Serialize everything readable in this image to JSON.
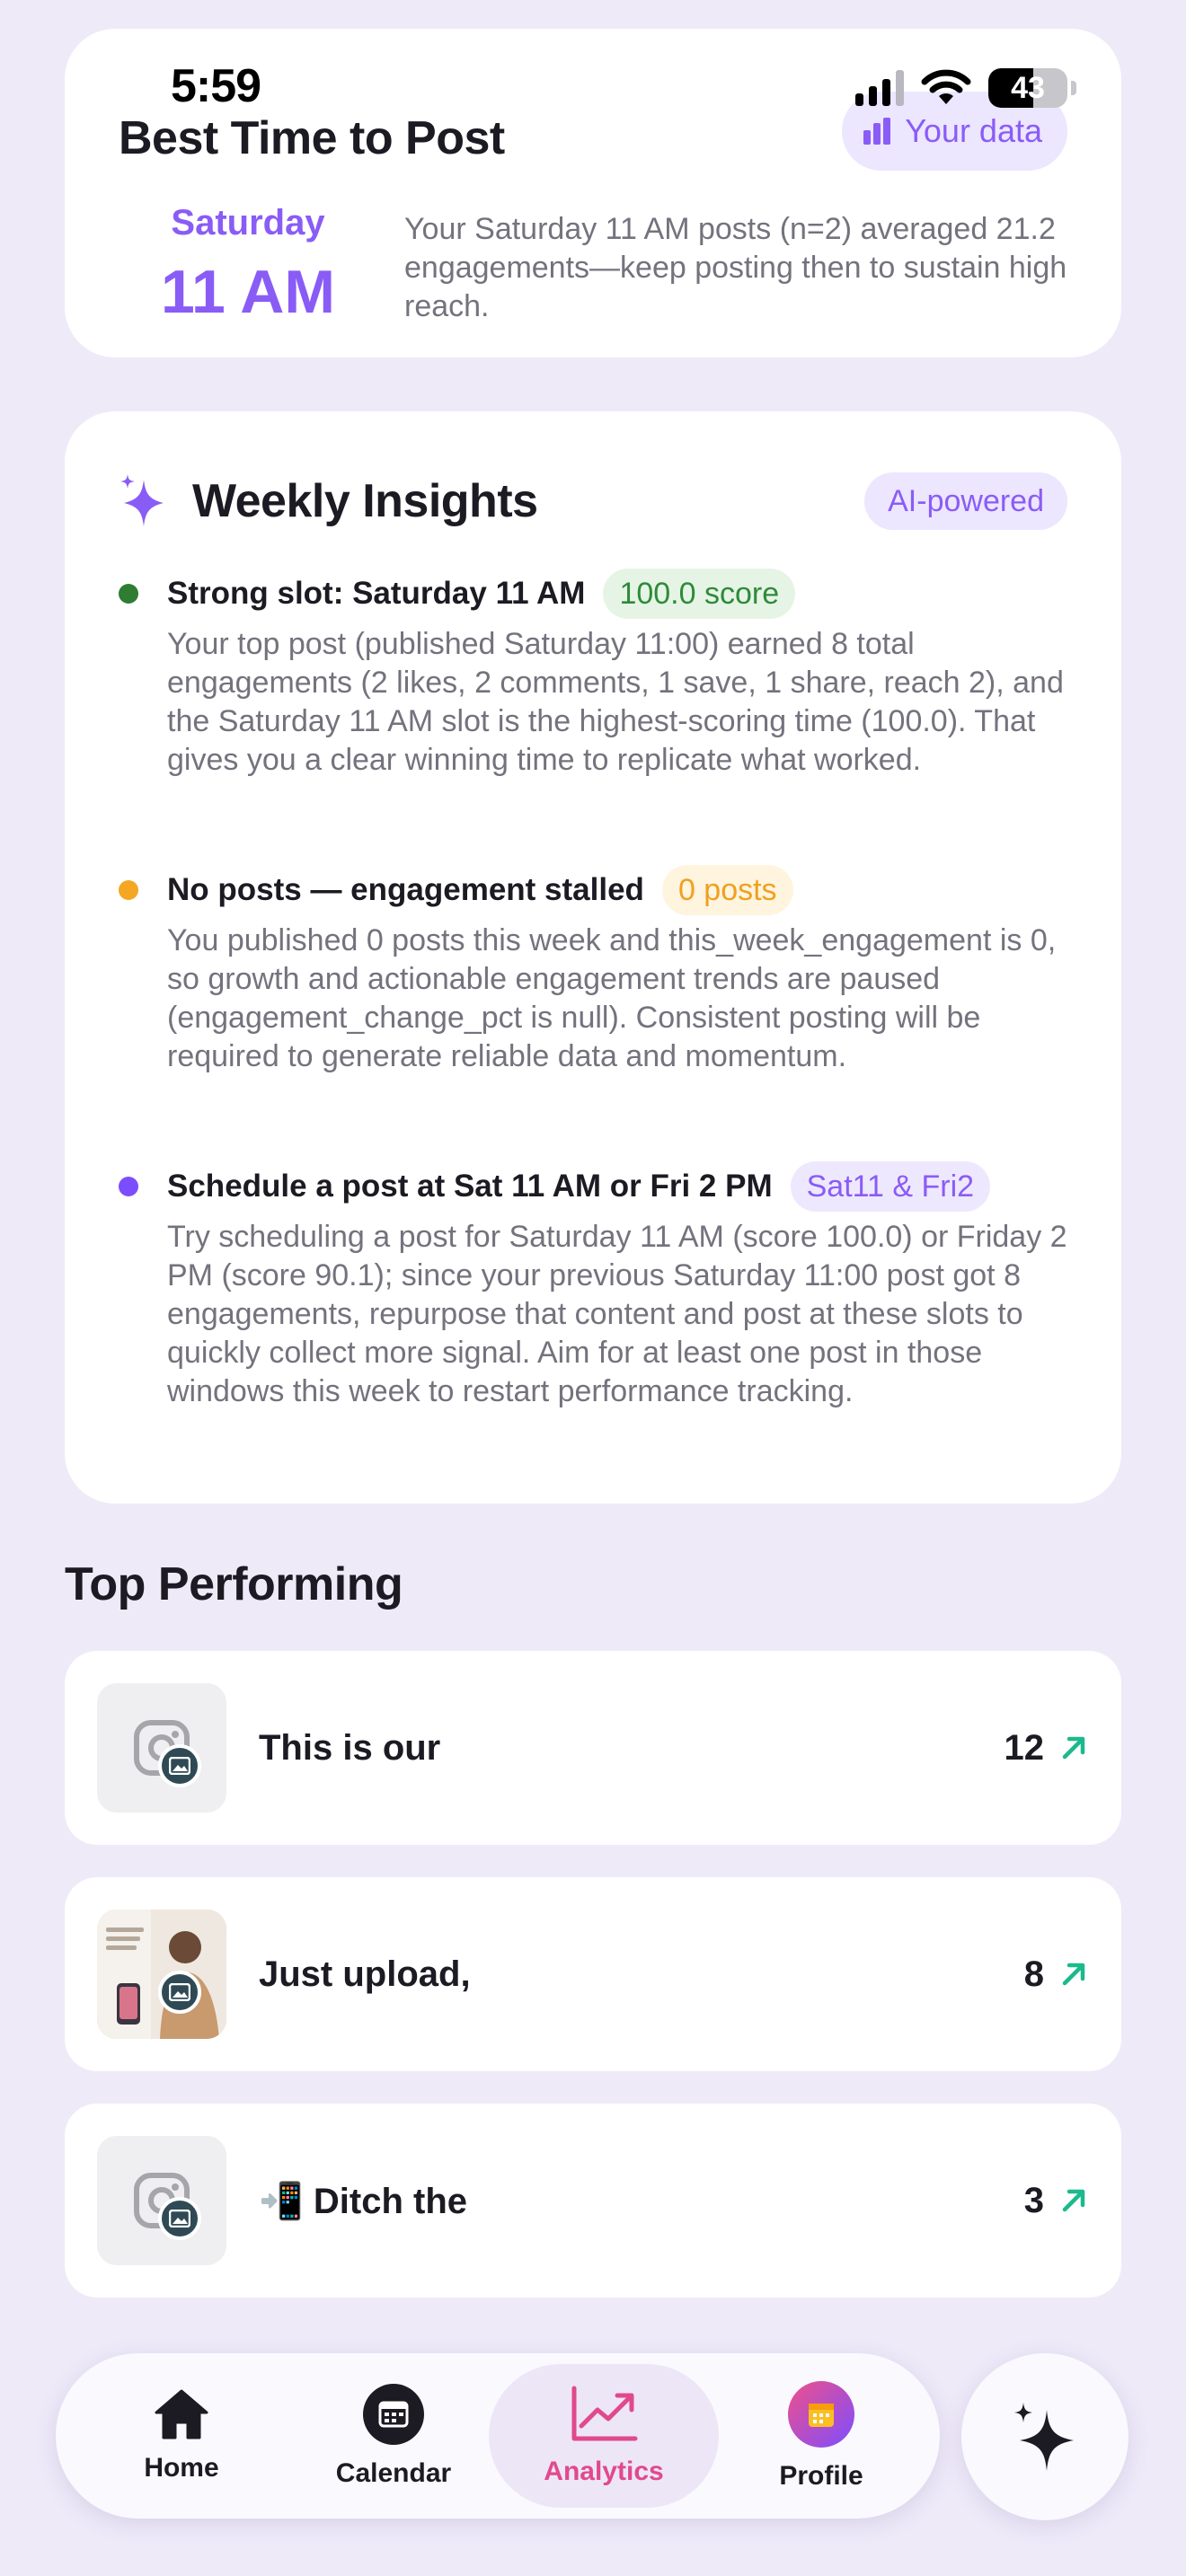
{
  "status_bar": {
    "time": "5:59",
    "battery": "43"
  },
  "best_time": {
    "title": "Best Time to Post",
    "chip_label": "Your data",
    "day": "Saturday",
    "hour": "11 AM",
    "description": "Your Saturday 11 AM posts (n=2) averaged 21.2 engagements—keep posting then to sustain high reach."
  },
  "insights": {
    "title": "Weekly Insights",
    "chip_label": "AI-powered",
    "items": [
      {
        "title": "Strong slot: Saturday 11 AM",
        "badge": "100.0 score",
        "dot_color": "#2e7d32",
        "badge_bg": "#E6F4E6",
        "badge_color": "#2e8b3a",
        "body": "Your top post (published Saturday 11:00) earned 8 total engagements (2 likes, 2 comments, 1 save, 1 share, reach 2), and the Saturday 11 AM slot is the highest-scoring time (100.0). That gives you a clear winning time to replicate what worked."
      },
      {
        "title": "No posts — engagement stalled",
        "badge": "0 posts",
        "dot_color": "#f5a623",
        "badge_bg": "#FFF4DE",
        "badge_color": "#f0a020",
        "body": "You published 0 posts this week and this_week_engagement is 0, so growth and actionable engagement trends are paused (engagement_change_pct is null). Consistent posting will be required to generate reliable data and momentum."
      },
      {
        "title": "Schedule a post at Sat 11 AM or Fri 2 PM",
        "badge": "Sat11 & Fri2",
        "dot_color": "#7c4dff",
        "badge_bg": "#EEE8FE",
        "badge_color": "#8a5cf6",
        "body": "Try scheduling a post for Saturday 11 AM (score 100.0) or Friday 2 PM (score 90.1); since your previous Saturday 11:00 post got 8 engagements, repurpose that content and post at these slots to quickly collect more signal. Aim for at least one post in those windows this week to restart performance tracking."
      }
    ]
  },
  "top_performing": {
    "title": "Top Performing",
    "posts": [
      {
        "title": "This is our",
        "metric": "12",
        "thumb": "instagram-placeholder"
      },
      {
        "title": "Just upload,",
        "metric": "8",
        "thumb": "photo"
      },
      {
        "title": "📲 Ditch the",
        "metric": "3",
        "thumb": "instagram-placeholder"
      }
    ]
  },
  "nav": {
    "tabs": [
      {
        "label": "Home",
        "icon": "home-icon"
      },
      {
        "label": "Calendar",
        "icon": "calendar-icon"
      },
      {
        "label": "Analytics",
        "icon": "analytics-icon",
        "active": true
      },
      {
        "label": "Profile",
        "icon": "profile-icon"
      }
    ],
    "fab_icon": "sparkle-icon"
  },
  "colors": {
    "background": "#EEEAF8",
    "accent_purple": "#8a5cf6",
    "trend_green": "#1bb98d",
    "active_tab": "#e04a8c"
  }
}
